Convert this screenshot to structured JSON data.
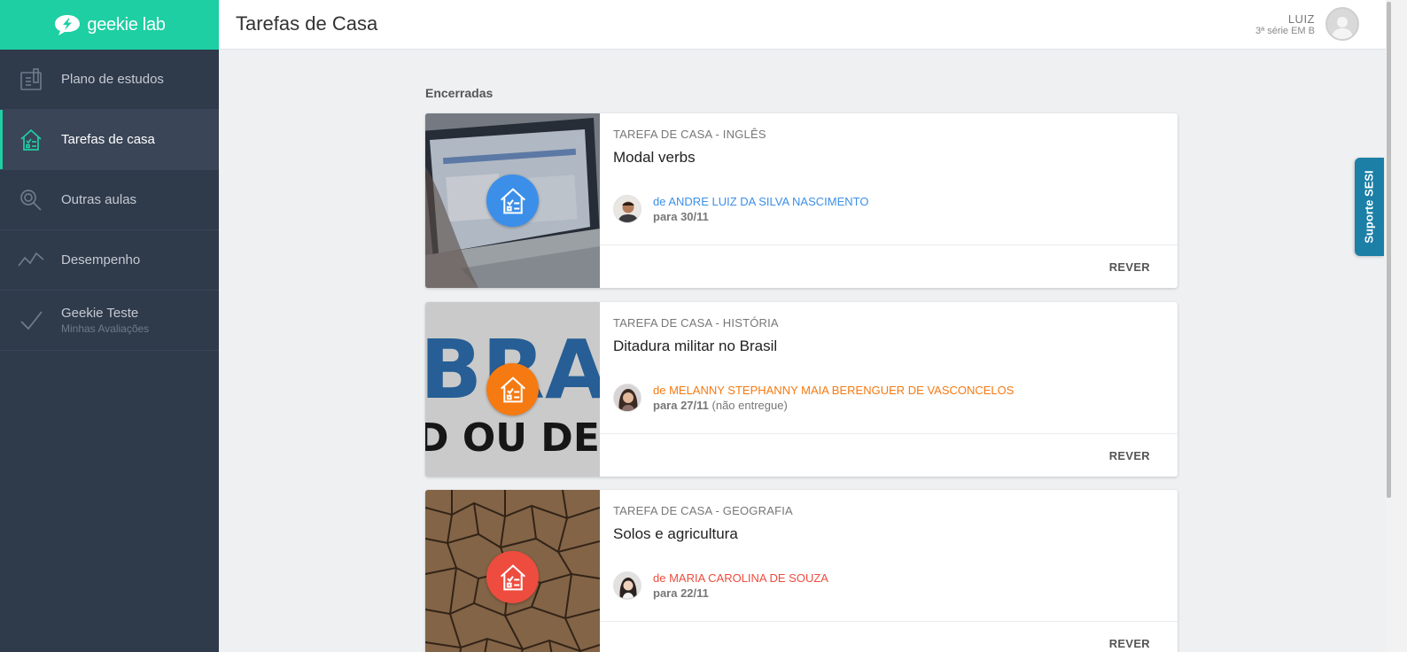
{
  "app": {
    "logo_text": "geekie lab",
    "logo_icon": "lightning-bubble-icon",
    "brand_color": "#1ecfa3",
    "sidebar_bg": "#2f3a4b"
  },
  "sidebar": {
    "items": [
      {
        "label": "Plano de estudos",
        "icon": "study-plan-icon",
        "active": false
      },
      {
        "label": "Tarefas de casa",
        "icon": "homework-house-icon",
        "active": true
      },
      {
        "label": "Outras aulas",
        "icon": "search-icon",
        "active": false
      },
      {
        "label": "Desempenho",
        "icon": "line-chart-icon",
        "active": false
      },
      {
        "label": "Geekie Teste",
        "sub": "Minhas Avaliações",
        "icon": "checkmark-icon",
        "active": false
      }
    ]
  },
  "header": {
    "title": "Tarefas de Casa",
    "user_name": "LUIZ",
    "user_class": "3ª série EM B"
  },
  "support": {
    "label": "Suporte SESI",
    "color": "#1b7fa6"
  },
  "main": {
    "section_title": "Encerradas",
    "tasks": [
      {
        "subject": "TAREFA DE CASA - INGLÊS",
        "title": "Modal verbs",
        "author": "de ANDRE LUIZ DA SILVA NASCIMENTO",
        "due": "para 30/11",
        "status": "",
        "accent": "#3b8fe8",
        "action": "REVER"
      },
      {
        "subject": "TAREFA DE CASA - HISTÓRIA",
        "title": "Ditadura militar no Brasil",
        "author": "de MELANNY STEPHANNY MAIA BERENGUER DE VASCONCELOS",
        "due": "para 27/11",
        "status": "(não entregue)",
        "accent": "#f57a12",
        "action": "REVER"
      },
      {
        "subject": "TAREFA DE CASA - GEOGRAFIA",
        "title": "Solos e agricultura",
        "author": "de MARIA CAROLINA DE SOUZA",
        "due": "para 22/11",
        "status": "",
        "accent": "#ee4c3e",
        "action": "REVER"
      }
    ]
  }
}
